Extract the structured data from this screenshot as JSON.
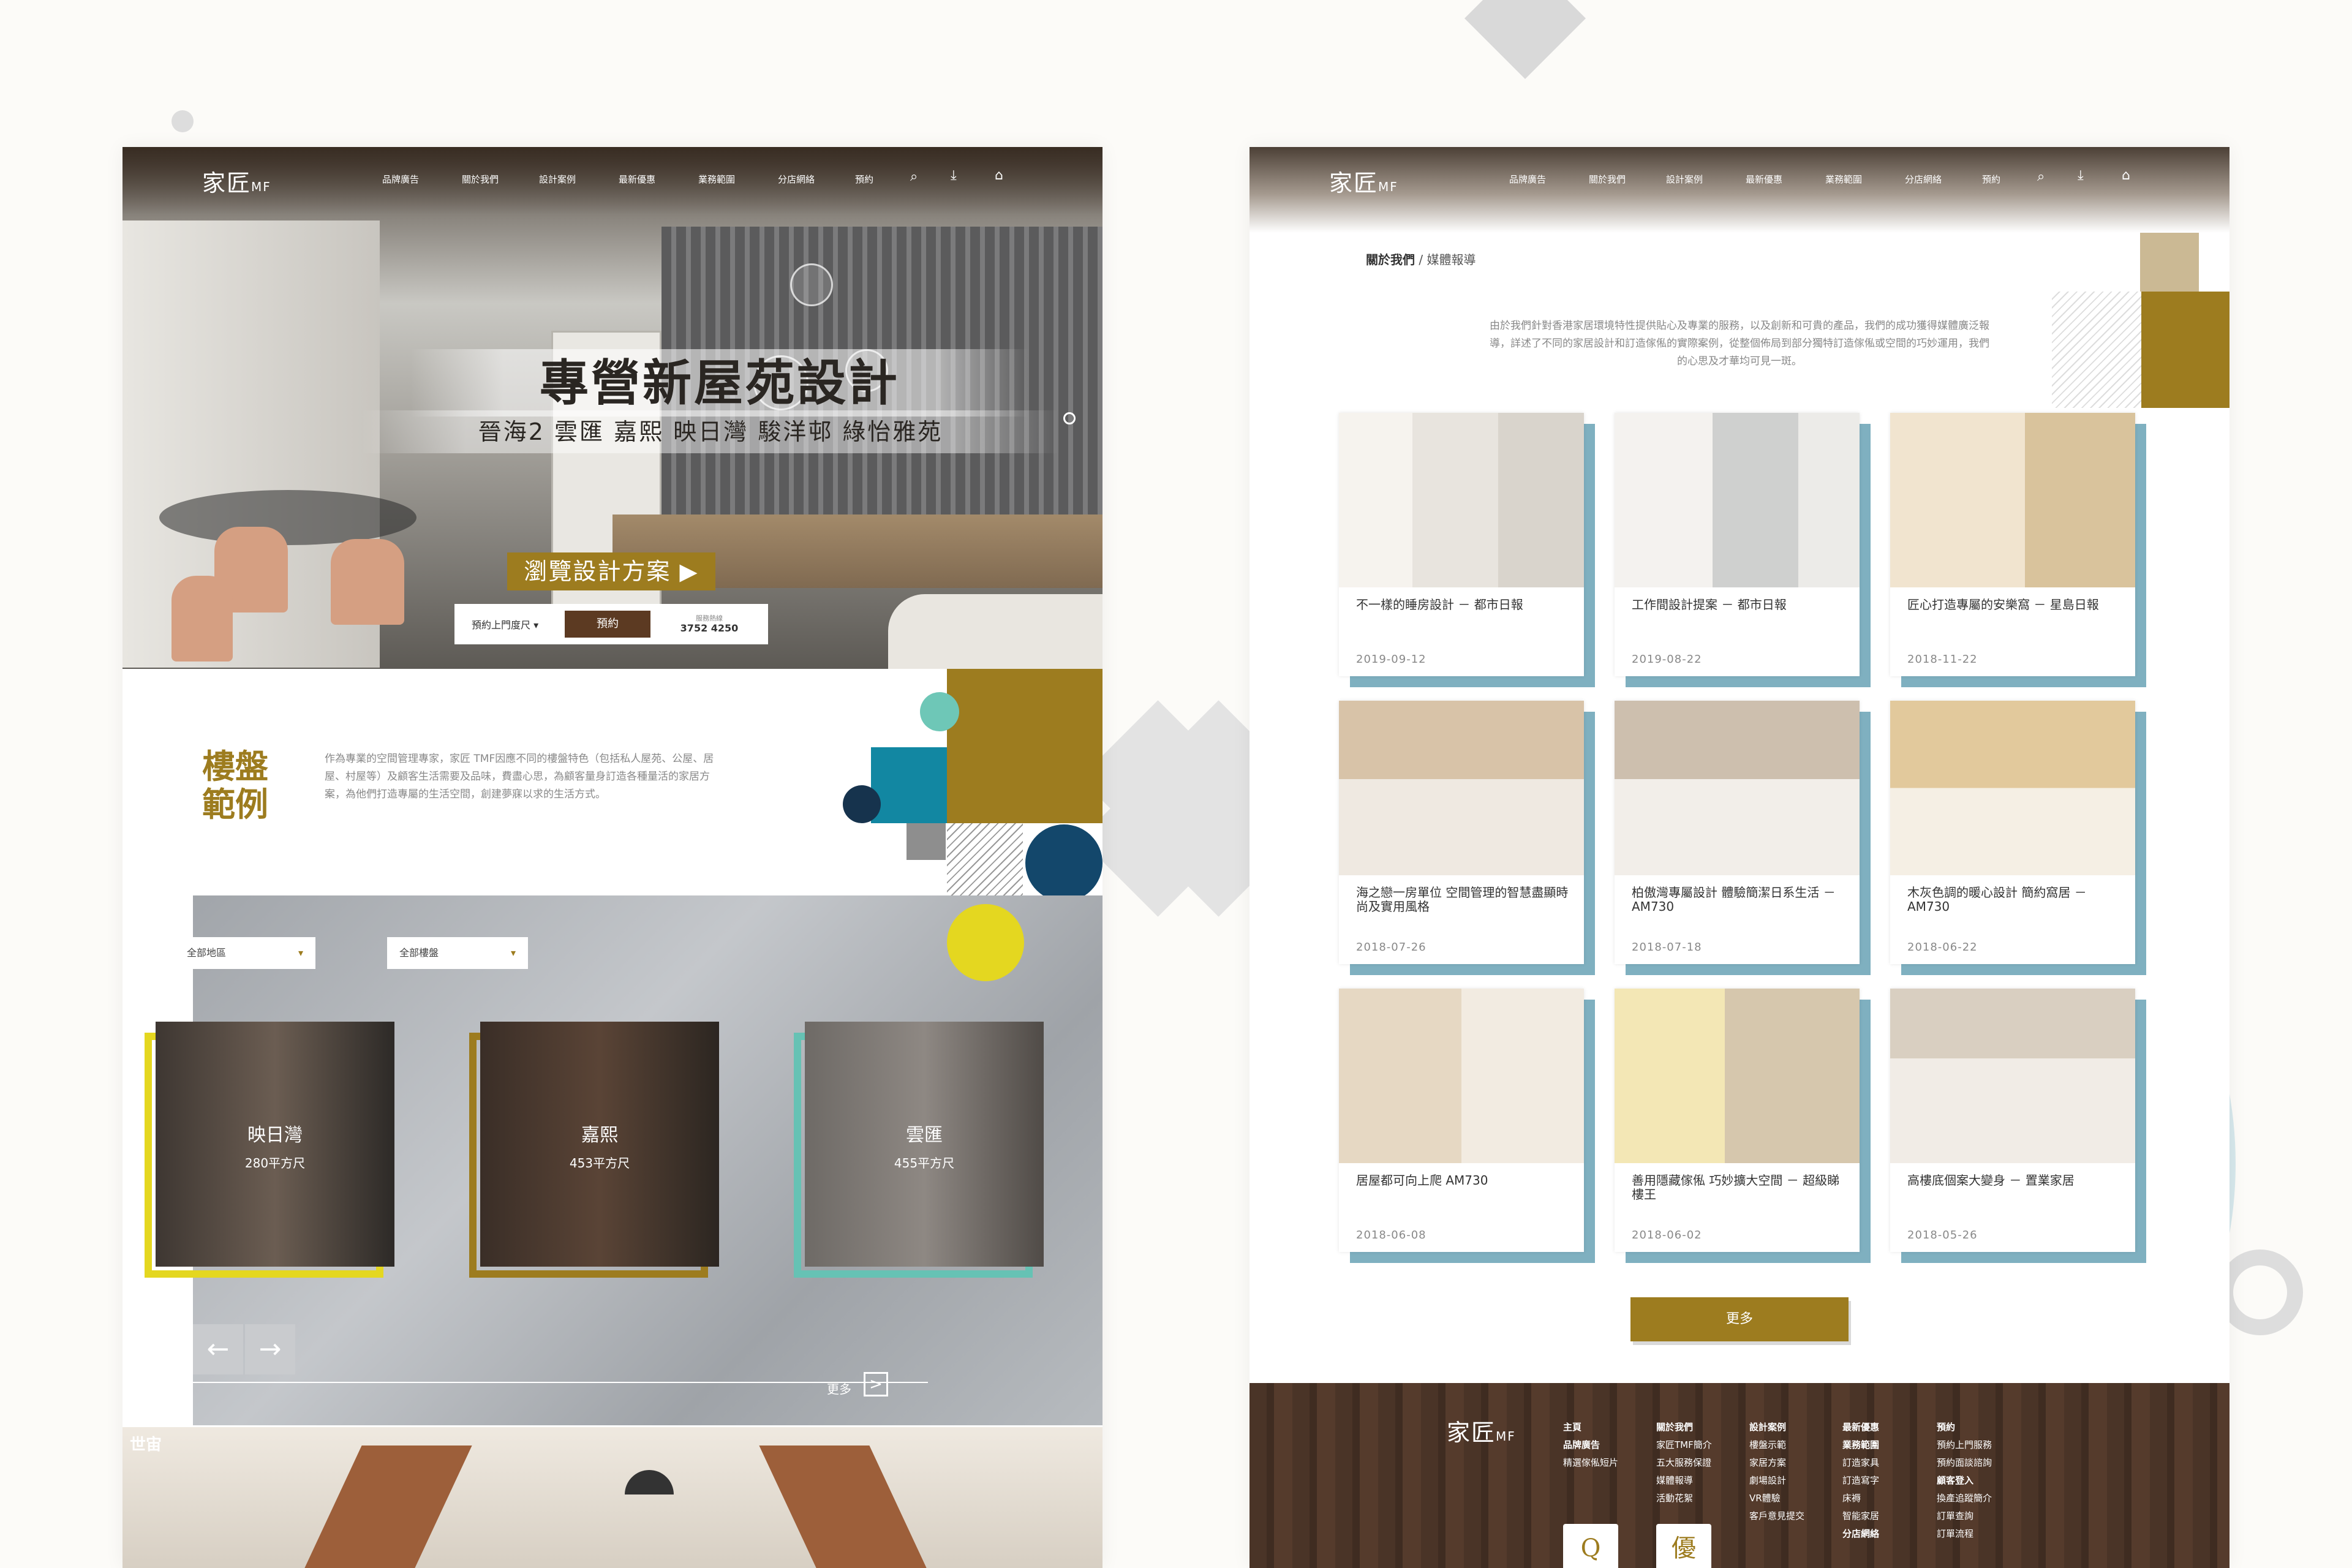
{
  "colors": {
    "accent_gold": "#9d7c1f",
    "dark_brown": "#5c3a22",
    "teal": "#7fb0c0",
    "yellow": "#e4d720",
    "navy": "#1f4a6b"
  },
  "left_page": {
    "nav": {
      "logo": "家匠",
      "logo_suffix": "MF",
      "items": [
        "品牌廣告",
        "關於我們",
        "設計案例",
        "最新優惠",
        "業務範圍",
        "分店網絡",
        "預約"
      ],
      "icons": [
        "search-icon",
        "download-icon",
        "home-search-icon"
      ]
    },
    "hero": {
      "title": "專營新屋苑設計",
      "subtitle": "晉海2  雲匯  嘉熙  映日灣  駿洋邨  綠怡雅苑",
      "browse_button": "瀏覽設計方案 ▶",
      "booking": {
        "select": "預約上門度尺 ▾",
        "button": "預約",
        "phone_label": "服務熱線",
        "phone": "3752 4250"
      }
    },
    "estates": {
      "title_line1": "樓盤",
      "title_line2": "範例",
      "description": "作為專業的空間管理專家，家匠 TMF因應不同的樓盤特色（包括私人屋苑、公屋、居屋、村屋等）及顧客生活需要及品味，費盡心思，為顧客量身訂造各種量活的家居方案，為他們打造專屬的生活空間，創建夢寐以求的生活方式。"
    },
    "filters": {
      "region": "全部地區",
      "estate": "全部樓盤"
    },
    "cards": [
      {
        "name": "映日灣",
        "area": "280平方尺",
        "frame": "#e4d720"
      },
      {
        "name": "嘉熙",
        "area": "453平方尺",
        "frame": "#9d7c1f"
      },
      {
        "name": "雲匯",
        "area": "455平方尺",
        "frame": "#66c2b4"
      }
    ],
    "carousel": {
      "prev": "←",
      "next": "→"
    },
    "more": "更多",
    "more_arrow": ">",
    "bottom_label": "世宙"
  },
  "right_page": {
    "nav": {
      "logo": "家匠",
      "logo_suffix": "MF",
      "items": [
        "品牌廣告",
        "關於我們",
        "設計案例",
        "最新優惠",
        "業務範圍",
        "分店網絡",
        "預約"
      ]
    },
    "breadcrumb": {
      "parent": "關於我們",
      "separator": " / ",
      "current": "媒體報導"
    },
    "intro": "由於我們針對香港家居環境特性提供貼心及專業的服務，以及創新和可貴的產品，我們的成功獲得媒體廣泛報導，詳述了不同的家居設計和訂造傢俬的實際案例，從整個佈局到部分獨特訂造傢俬或空間的巧妙運用，我們的心思及才華均可見一斑。",
    "articles": [
      {
        "title": "不一樣的睡房設計 － 都市日報",
        "date": "2019-09-12"
      },
      {
        "title": "工作間設計提案 － 都市日報",
        "date": "2019-08-22"
      },
      {
        "title": "匠心打造專屬的安樂窩 － 星島日報",
        "date": "2018-11-22"
      },
      {
        "title": "海之戀一房單位 空間管理的智慧盡顯時尚及實用風格",
        "date": "2018-07-26"
      },
      {
        "title": "柏傲灣專屬設計 體驗簡潔日系生活 － AM730",
        "date": "2018-07-18"
      },
      {
        "title": "木灰色調的暖心設計 簡約窩居 － AM730",
        "date": "2018-06-22"
      },
      {
        "title": "居屋都可向上爬 AM730",
        "date": "2018-06-08"
      },
      {
        "title": "善用隱藏傢俬 巧妙擴大空間 － 超級睇樓王",
        "date": "2018-06-02"
      },
      {
        "title": "高樓底個案大變身 － 置業家居",
        "date": "2018-05-26"
      }
    ],
    "more_button": "更多",
    "footer": {
      "logo": "家匠",
      "logo_suffix": "MF",
      "columns": [
        {
          "items": [
            "主頁",
            "品牌廣告",
            "精選傢俬短片"
          ]
        },
        {
          "items": [
            "關於我們",
            "家匠TMF簡介",
            "五大服務保證",
            "媒體報導",
            "活動花絮"
          ]
        },
        {
          "items": [
            "設計案例",
            "樓盤示範",
            "家居方案",
            "劇場設計",
            "VR體驗",
            "客戶意見提交"
          ]
        },
        {
          "items": [
            "最新優惠",
            "業務範圍",
            "訂造家具",
            "訂造寫字",
            "床褥",
            "智能家居",
            "分店網絡"
          ]
        },
        {
          "items": [
            "預約",
            "預約上門服務",
            "預約面談諮詢",
            "顧客登入",
            "換產追蹤簡介",
            "訂單查詢",
            "訂單流程"
          ]
        }
      ],
      "badges": [
        "Q",
        "優"
      ]
    }
  }
}
